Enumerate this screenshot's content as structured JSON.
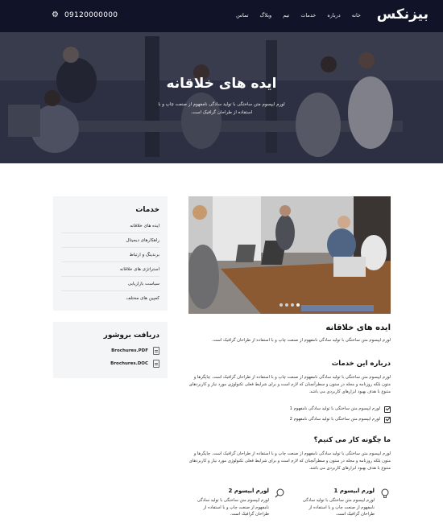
{
  "header": {
    "logo": "بیزنکس",
    "nav": [
      "خانه",
      "درباره",
      "خدمات",
      "تیم",
      "وبلاگ",
      "تماس"
    ],
    "phone": "09120000000"
  },
  "hero": {
    "title": "ایده های خلاقانه",
    "subtitle": "لورم ایپسوم متن ساختگی با تولید سادگی نامفهوم از صنعت چاپ و با استفاده از طراحان گرافیک است."
  },
  "sidebar": {
    "services_title": "خدمات",
    "services": [
      "ایده های خلاقانه",
      "راهکارهای دیجیتال",
      "برندینگ و ارتباط",
      "استراتژی های خلاقانه",
      "سیاست بازاریابی",
      "کمپین های مختلف"
    ],
    "brochure_title": "دریافت بروشور",
    "files": [
      "Brochures.PDF",
      "Brochures.DOC"
    ]
  },
  "main": {
    "title": "ایده های خلاقانه",
    "intro": "لورم ایپسوم متن ساختگی با تولید سادگی نامفهوم از صنعت چاپ و با استفاده از طراحان گرافیک است.",
    "about_title": "درباره این خدمات",
    "about_text": "لورم ایپسوم متن ساختگی با تولید سادگی نامفهوم از صنعت چاپ و با استفاده از طراحان گرافیک است. چاپگرها و متون بلکه روزنامه و مجله در ستون و سطرآنچنان که لازم است و برای شرایط فعلی تکنولوژی مورد نیاز و کاربردهای متنوع با هدف بهبود ابزارهای کاربردی می باشد.",
    "checks": [
      "لورم ایپسوم متن ساختگی با تولید سادگی نامفهوم 1",
      "لورم ایپسوم متن ساختگی با تولید سادگی نامفهوم 2"
    ],
    "how_title": "ما چگونه کار می کنیم؟",
    "how_text": "لورم ایپسوم متن ساختگی با تولید سادگی نامفهوم از صنعت چاپ و با استفاده از طراحان گرافیک است. چاپگرها و متون بلکه روزنامه و مجله در ستون و سطرآنچنان که لازم است و برای شرایط فعلی تکنولوژی مورد نیاز و کاربردهای متنوع با هدف بهبود ابزارهای کاربردی می باشد.",
    "features": [
      {
        "title": "لورم ایپسوم 1",
        "text": "لورم ایپسوم متن ساختگی با تولید سادگی نامفهوم از صنعت چاپ و با استفاده از طراحان گرافیک است.",
        "icon": "lightbulb-icon"
      },
      {
        "title": "لورم ایپسوم 2",
        "text": "لورم ایپسوم متن ساختگی با تولید سادگی نامفهوم از صنعت چاپ و با استفاده از طراحان گرافیک است.",
        "icon": "search-icon"
      }
    ]
  },
  "colors": {
    "topbar": "#111428",
    "sidebar_bg": "#f4f5f7"
  }
}
